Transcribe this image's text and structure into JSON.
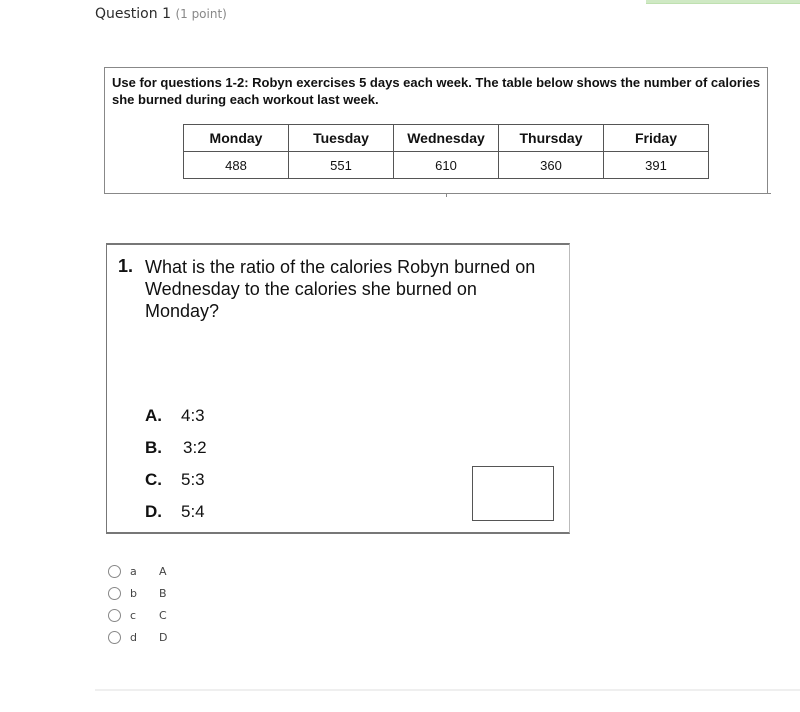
{
  "question": {
    "title": "Question 1",
    "points": "(1 point)"
  },
  "passage": {
    "text": "Use for questions 1-2:  Robyn exercises 5 days each week.  The table below shows the number of calories she burned during each workout last week.",
    "table": {
      "headers": [
        "Monday",
        "Tuesday",
        "Wednesday",
        "Thursday",
        "Friday"
      ],
      "values": [
        "488",
        "551",
        "610",
        "360",
        "391"
      ]
    }
  },
  "problem": {
    "number": "1.",
    "stem": "What is the ratio of the calories Robyn burned on Wednesday to the calories she burned on Monday?",
    "choices": [
      {
        "letter": "A.",
        "text": "4:3"
      },
      {
        "letter": "B.",
        "text": "3:2"
      },
      {
        "letter": "C.",
        "text": "5:3"
      },
      {
        "letter": "D.",
        "text": "5:4"
      }
    ]
  },
  "options": [
    {
      "key": "a",
      "value": "A",
      "selected": false
    },
    {
      "key": "b",
      "value": "B",
      "selected": false
    },
    {
      "key": "c",
      "value": "C",
      "selected": false
    },
    {
      "key": "d",
      "value": "D",
      "selected": false
    }
  ],
  "colors": {
    "accent_bar": "#cfe9c4"
  }
}
